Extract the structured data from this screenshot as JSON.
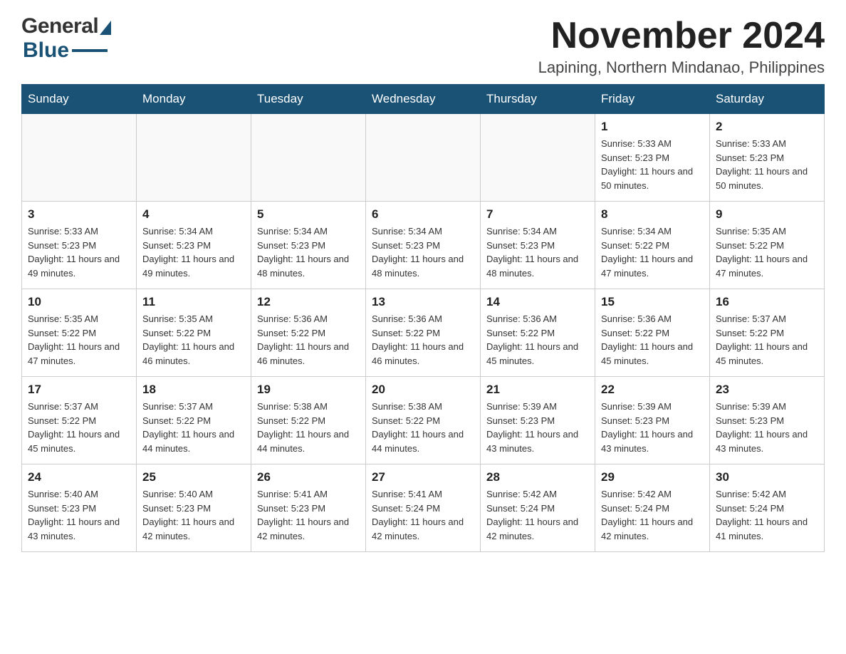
{
  "logo": {
    "general": "General",
    "blue": "Blue"
  },
  "title": {
    "month_year": "November 2024",
    "location": "Lapining, Northern Mindanao, Philippines"
  },
  "days_of_week": [
    "Sunday",
    "Monday",
    "Tuesday",
    "Wednesday",
    "Thursday",
    "Friday",
    "Saturday"
  ],
  "weeks": [
    {
      "days": [
        {
          "number": "",
          "info": ""
        },
        {
          "number": "",
          "info": ""
        },
        {
          "number": "",
          "info": ""
        },
        {
          "number": "",
          "info": ""
        },
        {
          "number": "",
          "info": ""
        },
        {
          "number": "1",
          "info": "Sunrise: 5:33 AM\nSunset: 5:23 PM\nDaylight: 11 hours and 50 minutes."
        },
        {
          "number": "2",
          "info": "Sunrise: 5:33 AM\nSunset: 5:23 PM\nDaylight: 11 hours and 50 minutes."
        }
      ]
    },
    {
      "days": [
        {
          "number": "3",
          "info": "Sunrise: 5:33 AM\nSunset: 5:23 PM\nDaylight: 11 hours and 49 minutes."
        },
        {
          "number": "4",
          "info": "Sunrise: 5:34 AM\nSunset: 5:23 PM\nDaylight: 11 hours and 49 minutes."
        },
        {
          "number": "5",
          "info": "Sunrise: 5:34 AM\nSunset: 5:23 PM\nDaylight: 11 hours and 48 minutes."
        },
        {
          "number": "6",
          "info": "Sunrise: 5:34 AM\nSunset: 5:23 PM\nDaylight: 11 hours and 48 minutes."
        },
        {
          "number": "7",
          "info": "Sunrise: 5:34 AM\nSunset: 5:23 PM\nDaylight: 11 hours and 48 minutes."
        },
        {
          "number": "8",
          "info": "Sunrise: 5:34 AM\nSunset: 5:22 PM\nDaylight: 11 hours and 47 minutes."
        },
        {
          "number": "9",
          "info": "Sunrise: 5:35 AM\nSunset: 5:22 PM\nDaylight: 11 hours and 47 minutes."
        }
      ]
    },
    {
      "days": [
        {
          "number": "10",
          "info": "Sunrise: 5:35 AM\nSunset: 5:22 PM\nDaylight: 11 hours and 47 minutes."
        },
        {
          "number": "11",
          "info": "Sunrise: 5:35 AM\nSunset: 5:22 PM\nDaylight: 11 hours and 46 minutes."
        },
        {
          "number": "12",
          "info": "Sunrise: 5:36 AM\nSunset: 5:22 PM\nDaylight: 11 hours and 46 minutes."
        },
        {
          "number": "13",
          "info": "Sunrise: 5:36 AM\nSunset: 5:22 PM\nDaylight: 11 hours and 46 minutes."
        },
        {
          "number": "14",
          "info": "Sunrise: 5:36 AM\nSunset: 5:22 PM\nDaylight: 11 hours and 45 minutes."
        },
        {
          "number": "15",
          "info": "Sunrise: 5:36 AM\nSunset: 5:22 PM\nDaylight: 11 hours and 45 minutes."
        },
        {
          "number": "16",
          "info": "Sunrise: 5:37 AM\nSunset: 5:22 PM\nDaylight: 11 hours and 45 minutes."
        }
      ]
    },
    {
      "days": [
        {
          "number": "17",
          "info": "Sunrise: 5:37 AM\nSunset: 5:22 PM\nDaylight: 11 hours and 45 minutes."
        },
        {
          "number": "18",
          "info": "Sunrise: 5:37 AM\nSunset: 5:22 PM\nDaylight: 11 hours and 44 minutes."
        },
        {
          "number": "19",
          "info": "Sunrise: 5:38 AM\nSunset: 5:22 PM\nDaylight: 11 hours and 44 minutes."
        },
        {
          "number": "20",
          "info": "Sunrise: 5:38 AM\nSunset: 5:22 PM\nDaylight: 11 hours and 44 minutes."
        },
        {
          "number": "21",
          "info": "Sunrise: 5:39 AM\nSunset: 5:23 PM\nDaylight: 11 hours and 43 minutes."
        },
        {
          "number": "22",
          "info": "Sunrise: 5:39 AM\nSunset: 5:23 PM\nDaylight: 11 hours and 43 minutes."
        },
        {
          "number": "23",
          "info": "Sunrise: 5:39 AM\nSunset: 5:23 PM\nDaylight: 11 hours and 43 minutes."
        }
      ]
    },
    {
      "days": [
        {
          "number": "24",
          "info": "Sunrise: 5:40 AM\nSunset: 5:23 PM\nDaylight: 11 hours and 43 minutes."
        },
        {
          "number": "25",
          "info": "Sunrise: 5:40 AM\nSunset: 5:23 PM\nDaylight: 11 hours and 42 minutes."
        },
        {
          "number": "26",
          "info": "Sunrise: 5:41 AM\nSunset: 5:23 PM\nDaylight: 11 hours and 42 minutes."
        },
        {
          "number": "27",
          "info": "Sunrise: 5:41 AM\nSunset: 5:24 PM\nDaylight: 11 hours and 42 minutes."
        },
        {
          "number": "28",
          "info": "Sunrise: 5:42 AM\nSunset: 5:24 PM\nDaylight: 11 hours and 42 minutes."
        },
        {
          "number": "29",
          "info": "Sunrise: 5:42 AM\nSunset: 5:24 PM\nDaylight: 11 hours and 42 minutes."
        },
        {
          "number": "30",
          "info": "Sunrise: 5:42 AM\nSunset: 5:24 PM\nDaylight: 11 hours and 41 minutes."
        }
      ]
    }
  ]
}
